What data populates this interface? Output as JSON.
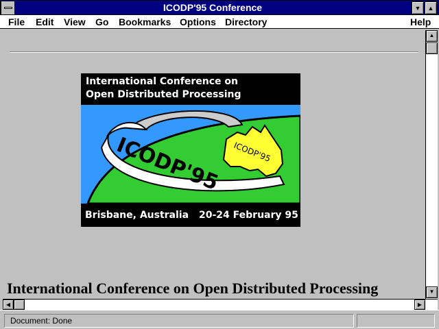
{
  "window": {
    "title": "ICODP'95 Conference"
  },
  "menu": {
    "file": "File",
    "edit": "Edit",
    "view": "View",
    "go": "Go",
    "bookmarks": "Bookmarks",
    "options": "Options",
    "directory": "Directory",
    "help": "Help"
  },
  "logo": {
    "line1": "International Conference on",
    "line2": "Open Distributed Processing",
    "ribbon_text": "ICODP'95",
    "map_text": "ICODP'95",
    "location": "Brisbane, Australia",
    "dates": "20-24 February 95"
  },
  "page": {
    "heading": "International Conference on Open Distributed Processing"
  },
  "status": {
    "text": "Document: Done"
  },
  "icons": {
    "system_menu": "minus-bar-icon",
    "minimize": "triangle-down-icon",
    "maximize": "triangle-up-icon",
    "scroll_up": "arrow-up-icon",
    "scroll_down": "arrow-down-icon",
    "scroll_left": "arrow-left-icon",
    "scroll_right": "arrow-right-icon"
  },
  "colors": {
    "titlebar": "#000080",
    "window_bg": "#c0c0c0",
    "logo_sky": "#3399ff",
    "logo_land": "#33cc33",
    "australia": "#ffff33"
  }
}
